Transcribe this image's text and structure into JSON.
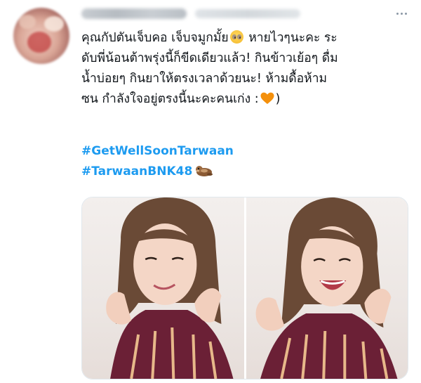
{
  "tweet": {
    "more_icon": "more-horizontal-icon",
    "text_lines": [
      "คุณกัปตันเจ็บคอ เจ็บจมูกมั้ย",
      " หายไวๆนะคะ ระ",
      "ดับพี่น้อนต้าพรุ่งนี้ก็ขีดเดียวแล้ว! กินข้าวเย้อๆ ดื่ม",
      "น้ำบ่อยๆ กินยาให้ตรงเวลาด้วยนะ! ห้ามดื้อห้าม",
      "ซน กำลังใจอยู่ตรงนี้นะคะคนเก่ง :",
      ")"
    ],
    "emojis": [
      "pleading-face-emoji",
      "orange-heart-emoji"
    ],
    "hashtags": [
      "#GetWellSoonTarwaan",
      "#TarwaanBNK48"
    ],
    "hashtag_emoji": "otter-emoji",
    "colors": {
      "link": "#1d9bf0",
      "text": "#0f1419",
      "meta": "#8b98a5"
    }
  },
  "media": {
    "count": 2,
    "photos": [
      {
        "name": "photo-1"
      },
      {
        "name": "photo-2"
      }
    ]
  }
}
